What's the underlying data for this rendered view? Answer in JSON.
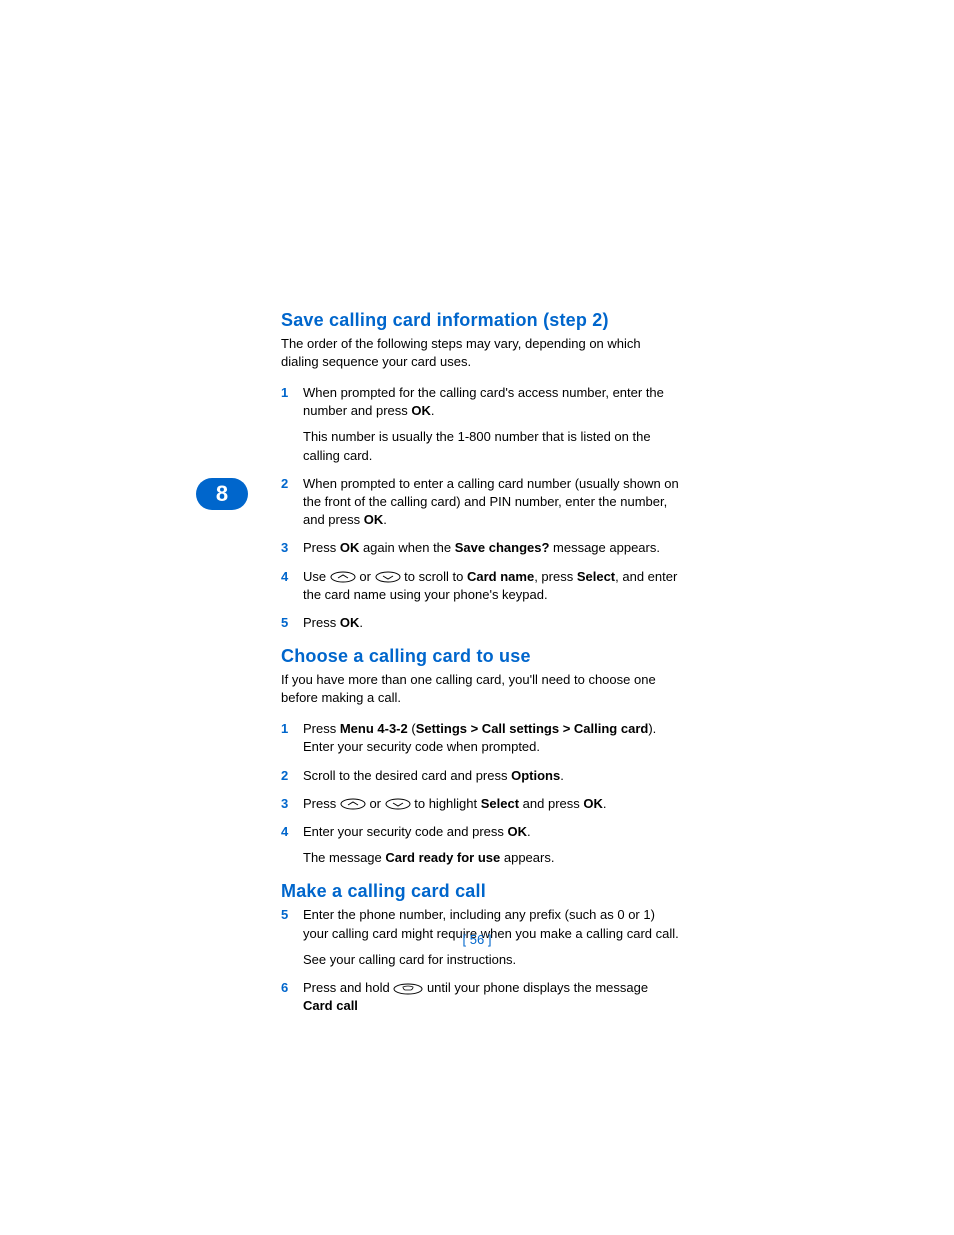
{
  "chapter_number": "8",
  "page_number": "[ 56 ]",
  "sections": [
    {
      "heading": "Save calling card information (step 2)",
      "intro": "The order of the following steps may vary, depending on which dialing sequence your card uses.",
      "steps": [
        {
          "n": "1",
          "para1_a": "When prompted for the calling card's access number, enter the number and press ",
          "para1_bold": "OK",
          "para1_b": ".",
          "para2": "This number is usually the 1-800 number that is listed on the calling card."
        },
        {
          "n": "2",
          "para1_a": "When prompted to enter a calling card number (usually shown on the front of the calling card) and PIN number, enter the number, and press ",
          "para1_bold": "OK",
          "para1_b": "."
        },
        {
          "n": "3",
          "a": "Press ",
          "b1": "OK",
          "mid1": " again when the ",
          "b2": "Save changes?",
          "end": " message appears."
        },
        {
          "n": "4",
          "a": "Use ",
          "mid1": " or ",
          "mid2": " to scroll to ",
          "b1": "Card name",
          "mid3": ", press ",
          "b2": "Select",
          "end": ", and enter the card name using your phone's keypad."
        },
        {
          "n": "5",
          "a": "Press ",
          "b1": "OK",
          "end": "."
        }
      ]
    },
    {
      "heading": "Choose a calling card to use",
      "intro": "If you have more than one calling card, you'll need to choose one before making a call.",
      "steps": [
        {
          "n": "1",
          "a": "Press ",
          "b1": "Menu 4-3-2",
          "mid1": " (",
          "b2": "Settings > Call settings > Calling card",
          "mid2": "). Enter your security code when prompted."
        },
        {
          "n": "2",
          "a": "Scroll to the desired card and press ",
          "b1": "Options",
          "end": "."
        },
        {
          "n": "3",
          "a": "Press ",
          "mid1": " or ",
          "mid2": " to highlight ",
          "b1": "Select",
          "mid3": " and press ",
          "b2": "OK",
          "end": "."
        },
        {
          "n": "4",
          "a": "Enter your security code and press ",
          "b1": "OK",
          "end": ".",
          "para2_a": "The message ",
          "para2_b": "Card ready for use",
          "para2_c": " appears."
        }
      ]
    },
    {
      "heading": "Make a calling card call",
      "steps": [
        {
          "n": "5",
          "para1": "Enter the phone number, including any prefix (such as 0 or 1) your calling card might require when you make a calling card call.",
          "para2": "See your calling card for instructions."
        },
        {
          "n": "6",
          "a": "Press and hold ",
          "mid": " until your phone displays the message ",
          "b1": "Card call"
        }
      ]
    }
  ]
}
